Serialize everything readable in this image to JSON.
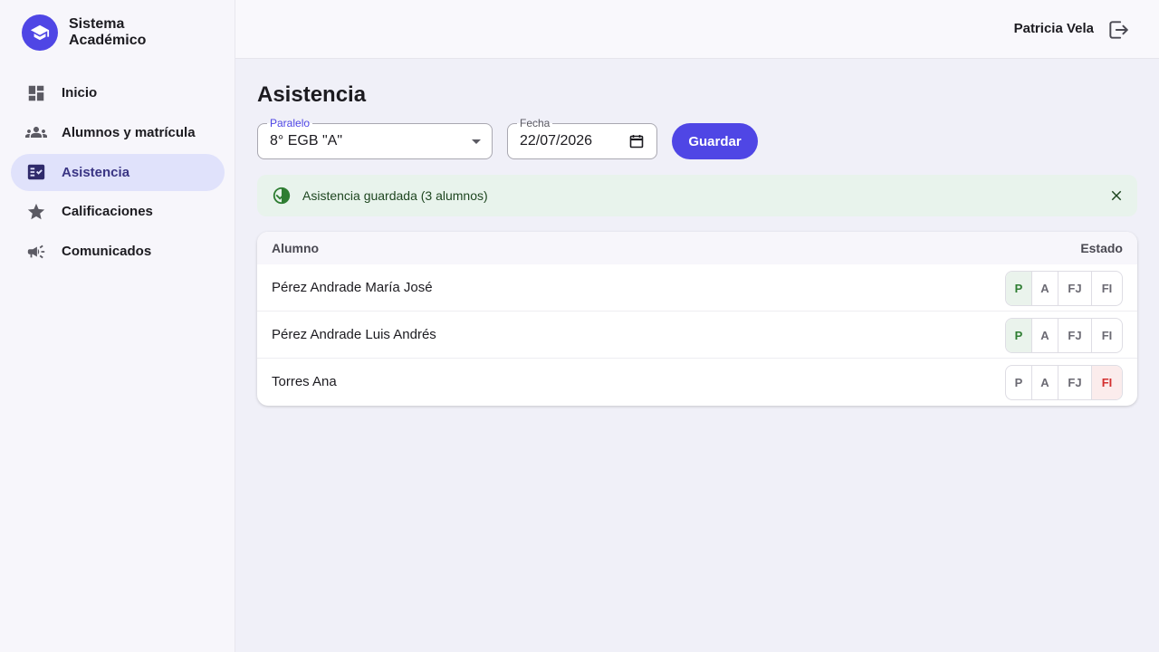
{
  "brand": {
    "name": "Sistema Académico"
  },
  "sidebar": {
    "items": [
      {
        "label": "Inicio",
        "icon": "dashboard-icon",
        "active": false
      },
      {
        "label": "Alumnos y matrícula",
        "icon": "people-icon",
        "active": false
      },
      {
        "label": "Asistencia",
        "icon": "fact-check-icon",
        "active": true
      },
      {
        "label": "Calificaciones",
        "icon": "star-icon",
        "active": false
      },
      {
        "label": "Comunicados",
        "icon": "campaign-icon",
        "active": false
      }
    ]
  },
  "topbar": {
    "user_name": "Patricia Vela",
    "logout_icon": "logout-icon"
  },
  "page": {
    "title": "Asistencia"
  },
  "filters": {
    "paralelo": {
      "label": "Paralelo",
      "value": "8° EGB \"A\""
    },
    "fecha": {
      "label": "Fecha",
      "value": "22/07/2026"
    },
    "save_label": "Guardar"
  },
  "alert": {
    "text": "Asistencia guardada (3 alumnos)",
    "type": "success"
  },
  "table": {
    "headers": {
      "alumno": "Alumno",
      "estado": "Estado"
    },
    "options": [
      "P",
      "A",
      "FJ",
      "FI"
    ],
    "rows": [
      {
        "name": "Pérez Andrade María José",
        "estado": "P"
      },
      {
        "name": "Pérez Andrade Luis Andrés",
        "estado": "P"
      },
      {
        "name": "Torres Ana",
        "estado": "FI"
      }
    ]
  },
  "colors": {
    "primary": "#4f46e5",
    "present": "#2e7d32",
    "injustified": "#d32f2f",
    "success_bg": "#e8f3ec"
  }
}
